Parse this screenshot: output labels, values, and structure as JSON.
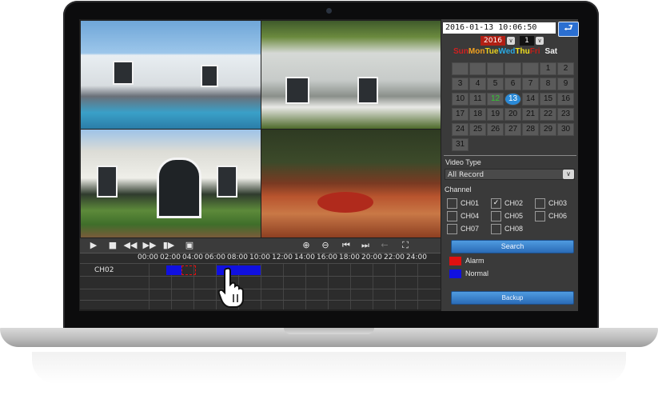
{
  "datetime": "2016-01-13    10:06:50",
  "calendar": {
    "year": "2016",
    "month": "1",
    "weekdays": [
      {
        "label": "Sun",
        "color": "#d02020"
      },
      {
        "label": "Mon",
        "color": "#f0a020"
      },
      {
        "label": "Tue",
        "color": "#e8d020"
      },
      {
        "label": "Wed",
        "color": "#2aa8e0"
      },
      {
        "label": "Thu",
        "color": "#f0e020"
      },
      {
        "label": "Fri",
        "color": "#c02018"
      },
      {
        "label": "Sat",
        "color": "#f0f0f0"
      }
    ],
    "days": [
      "",
      "",
      "",
      "",
      "",
      "1",
      "2",
      "3",
      "4",
      "5",
      "6",
      "7",
      "8",
      "9",
      "10",
      "11",
      "12",
      "13",
      "14",
      "15",
      "16",
      "17",
      "18",
      "19",
      "20",
      "21",
      "22",
      "23",
      "24",
      "25",
      "26",
      "27",
      "28",
      "29",
      "30",
      "31"
    ],
    "recorded_day": "12",
    "selected_day": "13"
  },
  "video_type": {
    "label": "Video Type",
    "value": "All Record"
  },
  "channel": {
    "label": "Channel",
    "items": [
      {
        "name": "CH01",
        "checked": false
      },
      {
        "name": "CH02",
        "checked": true
      },
      {
        "name": "CH03",
        "checked": false
      },
      {
        "name": "CH04",
        "checked": false
      },
      {
        "name": "CH05",
        "checked": false
      },
      {
        "name": "CH06",
        "checked": false
      },
      {
        "name": "CH07",
        "checked": false
      },
      {
        "name": "CH08",
        "checked": false
      }
    ]
  },
  "buttons": {
    "search": "Search",
    "backup": "Backup"
  },
  "legend": {
    "alarm": "Alarm",
    "normal": "Normal",
    "alarm_color": "#e01010",
    "normal_color": "#1010e0"
  },
  "timeline": {
    "hours": [
      "00:00",
      "02:00",
      "04:00",
      "06:00",
      "08:00",
      "10:00",
      "12:00",
      "14:00",
      "16:00",
      "18:00",
      "20:00",
      "22:00",
      "24:00"
    ],
    "channel": "CH02",
    "segments": [
      {
        "type": "normal",
        "start_h": 1.6,
        "end_h": 2.9
      },
      {
        "type": "alarm",
        "start_h": 2.9,
        "end_h": 4.2
      },
      {
        "type": "normal",
        "start_h": 6.1,
        "end_h": 10.0
      }
    ]
  }
}
